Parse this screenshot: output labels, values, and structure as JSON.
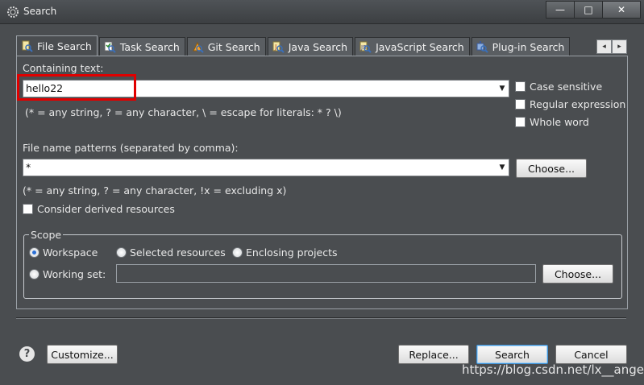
{
  "window": {
    "title": "Search",
    "minimize": "—",
    "maximize": "□",
    "close": "✕"
  },
  "tabs": [
    {
      "label": "File Search",
      "icon": "file-search-icon"
    },
    {
      "label": "Task Search",
      "icon": "task-search-icon"
    },
    {
      "label": "Git Search",
      "icon": "git-search-icon"
    },
    {
      "label": "Java Search",
      "icon": "java-search-icon"
    },
    {
      "label": "JavaScript Search",
      "icon": "javascript-search-icon"
    },
    {
      "label": "Plug-in Search",
      "icon": "plugin-search-icon"
    }
  ],
  "tab_arrows": {
    "left": "◂",
    "right": "▸"
  },
  "containing": {
    "label": "Containing text:",
    "value": "hello22",
    "hint": "(* = any string, ? = any character, \\ = escape for literals: * ? \\)",
    "case_sensitive": "Case sensitive",
    "regex": "Regular expression",
    "whole_word": "Whole word"
  },
  "file_patterns": {
    "label": "File name patterns (separated by comma):",
    "value": "*",
    "choose": "Choose...",
    "hint": "(* = any string, ? = any character, !x = excluding x)",
    "derived": "Consider derived resources"
  },
  "scope": {
    "title": "Scope",
    "workspace": "Workspace",
    "selected": "Selected resources",
    "enclosing": "Enclosing projects",
    "working_set": "Working set:",
    "working_set_value": "",
    "choose": "Choose..."
  },
  "footer": {
    "customize": "Customize...",
    "replace": "Replace...",
    "search": "Search",
    "cancel": "Cancel"
  },
  "watermark": "https://blog.csdn.net/lx__angel",
  "colors": {
    "highlight": "#e00000",
    "accent": "#3b8fd6"
  }
}
